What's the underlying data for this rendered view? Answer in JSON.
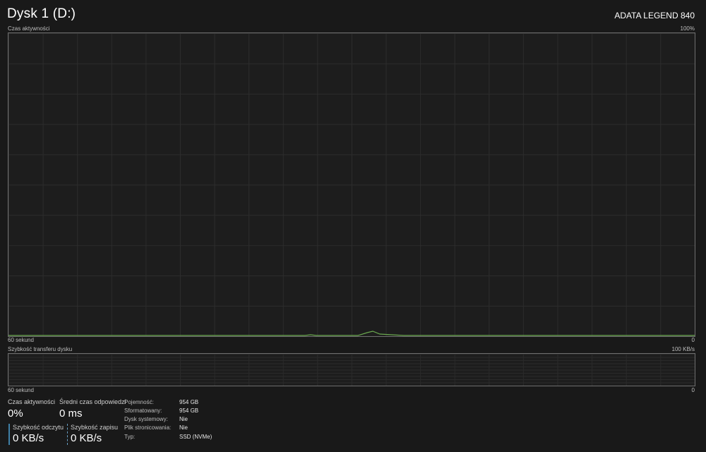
{
  "header": {
    "title": "Dysk 1 (D:)",
    "device_name": "ADATA LEGEND 840"
  },
  "activity_graph": {
    "label": "Czas aktywności",
    "max_label": "100%",
    "time_label": "60 sekund",
    "min_label": "0",
    "accent_color": "#6aa84f"
  },
  "transfer_graph": {
    "label": "Szybkość transferu dysku",
    "max_label": "100 KB/s",
    "time_label": "60 sekund",
    "min_label": "0",
    "accent_color": "#3f7fa6"
  },
  "stats": {
    "active_time_label": "Czas aktywności",
    "active_time_value": "0%",
    "response_time_label": "Średni czas odpowiedzi",
    "response_time_value": "0 ms",
    "read_speed_label": "Szybkość odczytu",
    "read_speed_value": "0 KB/s",
    "write_speed_label": "Szybkość zapisu",
    "write_speed_value": "0 KB/s"
  },
  "info": {
    "capacity_label": "Pojemność:",
    "capacity_value": "954 GB",
    "formatted_label": "Sformatowany:",
    "formatted_value": "954 GB",
    "system_disk_label": "Dysk systemowy:",
    "system_disk_value": "Nie",
    "page_file_label": "Plik stronicowania:",
    "page_file_value": "Nie",
    "type_label": "Typ:",
    "type_value": "SSD (NVMe)"
  }
}
